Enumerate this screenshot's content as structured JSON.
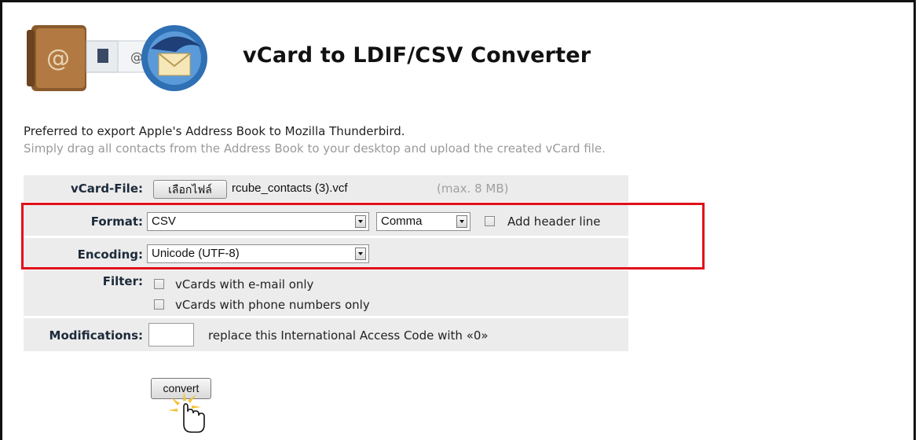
{
  "app": {
    "title": "vCard to LDIF/CSV Converter",
    "intro_line1": "Preferred to export Apple's Address Book to Mozilla Thunderbird.",
    "intro_line2": "Simply drag all contacts from the Address Book to your desktop and upload the created vCard file."
  },
  "form": {
    "vcard_file": {
      "label": "vCard-File:",
      "button_label": "เลือกไฟล์",
      "filename": "rcube_contacts (3).vcf",
      "note": "(max. 8 MB)"
    },
    "format": {
      "label": "Format:",
      "format_value": "CSV",
      "delimiter_value": "Comma",
      "header_checkbox_label": "Add header line",
      "header_checked": false
    },
    "encoding": {
      "label": "Encoding:",
      "value": "Unicode (UTF-8)"
    },
    "filter": {
      "label": "Filter:",
      "option1": "vCards with e-mail only",
      "option2": "vCards with phone numbers only"
    },
    "modifications": {
      "label": "Modifications:",
      "input_value": "",
      "description": "replace this International Access Code with «0»"
    },
    "convert_label": "convert"
  },
  "colors": {
    "highlight": "#e0101a",
    "row_bg": "#ececec",
    "label_text": "#1d2a3a"
  },
  "icons": [
    "address-book-icon",
    "thunderbird-icon",
    "hand-cursor-icon"
  ]
}
